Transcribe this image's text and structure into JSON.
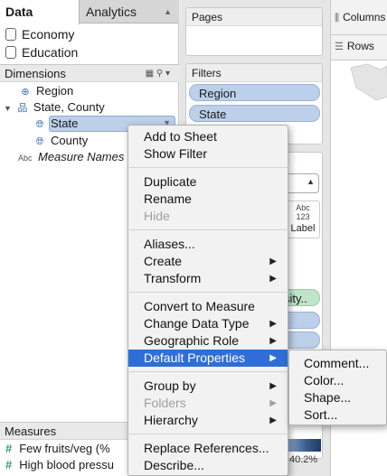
{
  "tabs": {
    "data": "Data",
    "analytics": "Analytics"
  },
  "datasources": [
    "Economy",
    "Education"
  ],
  "dimensions": {
    "header": "Dimensions",
    "fields": [
      {
        "label": "Region",
        "icon": "geo-group-icon"
      },
      {
        "label": "State, County",
        "icon": "hierarchy-icon"
      },
      {
        "label": "State",
        "icon": "globe-icon"
      },
      {
        "label": "County",
        "icon": "globe-icon"
      },
      {
        "label": "Measure Names",
        "icon": "abc-icon",
        "icon_text": "Abc"
      }
    ]
  },
  "measures": {
    "header": "Measures",
    "fields": [
      "Few fruits/veg (%",
      "High blood pressu"
    ]
  },
  "shelves": {
    "pages": "Pages",
    "filters": "Filters",
    "filter_pills": [
      "Region",
      "State"
    ],
    "columns": "Columns",
    "rows": "Rows",
    "marks_partial_pill": "sity..",
    "label_button": {
      "icon_text_1": "Abc",
      "icon_text_2": "123",
      "label": "Label"
    }
  },
  "legend": {
    "value": "40.2%"
  },
  "context_menu": {
    "groups": [
      [
        {
          "label": "Add to Sheet"
        },
        {
          "label": "Show Filter"
        }
      ],
      [
        {
          "label": "Duplicate"
        },
        {
          "label": "Rename"
        },
        {
          "label": "Hide",
          "disabled": true
        }
      ],
      [
        {
          "label": "Aliases..."
        },
        {
          "label": "Create",
          "submenu": true
        },
        {
          "label": "Transform",
          "submenu": true
        }
      ],
      [
        {
          "label": "Convert to Measure"
        },
        {
          "label": "Change Data Type",
          "submenu": true
        },
        {
          "label": "Geographic Role",
          "submenu": true
        },
        {
          "label": "Default Properties",
          "submenu": true,
          "active": true
        }
      ],
      [
        {
          "label": "Group by",
          "submenu": true
        },
        {
          "label": "Folders",
          "submenu": true,
          "disabled": true
        },
        {
          "label": "Hierarchy",
          "submenu": true
        }
      ],
      [
        {
          "label": "Replace References..."
        },
        {
          "label": "Describe..."
        }
      ]
    ]
  },
  "submenu": [
    "Comment...",
    "Color...",
    "Shape...",
    "Sort..."
  ],
  "colors": {
    "highlight": "#2f6ed7",
    "pill_blue": "#bcd0ea",
    "pill_green": "#bfe4c9"
  }
}
